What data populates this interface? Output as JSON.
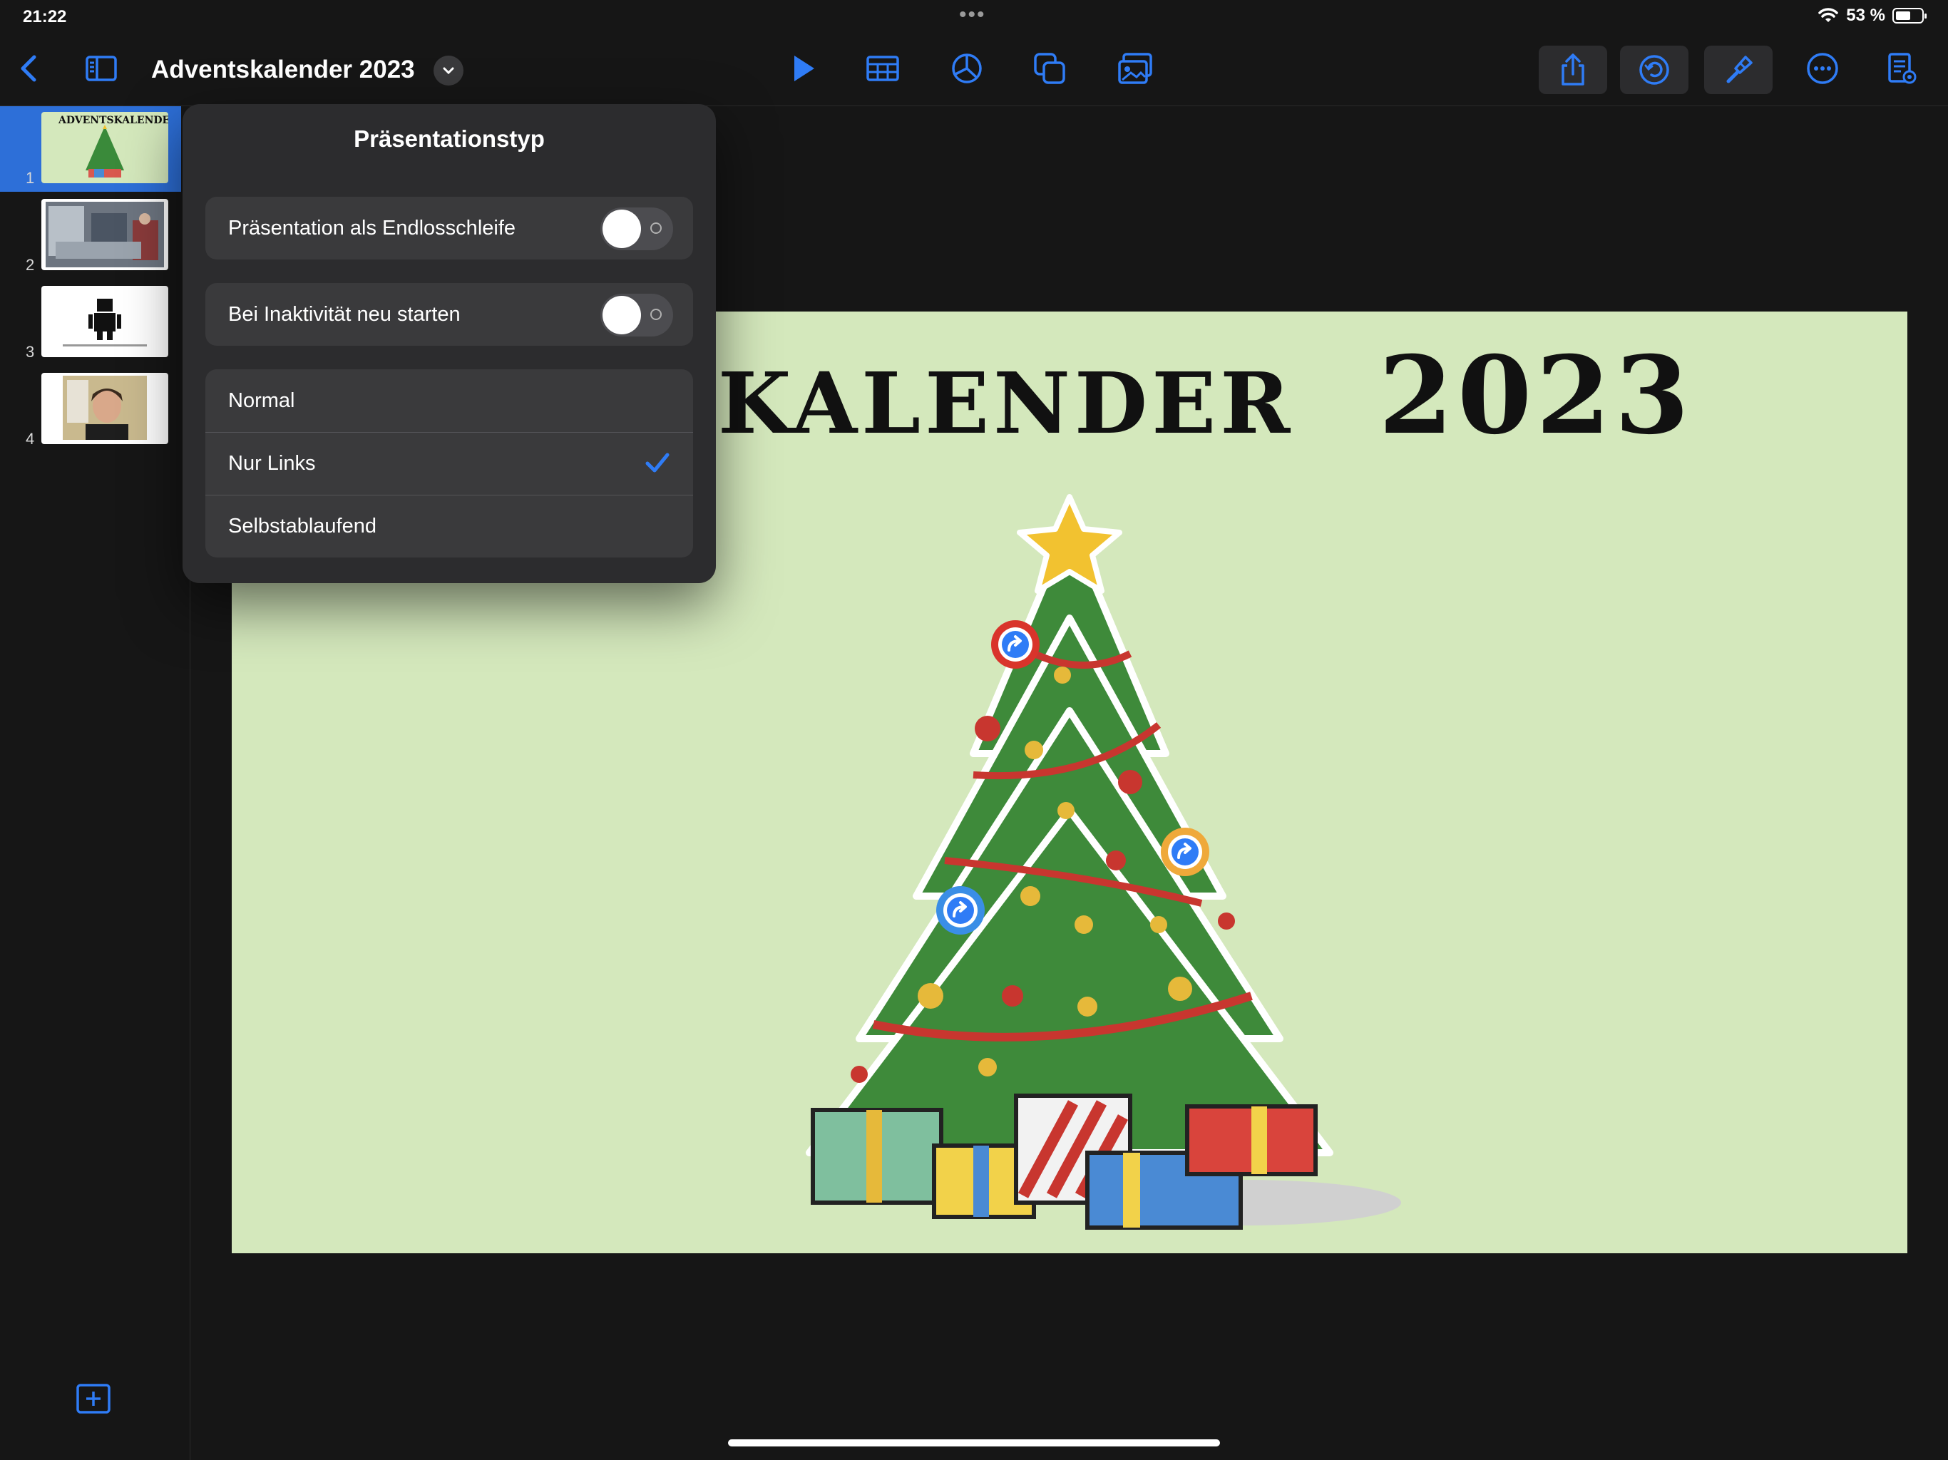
{
  "status_bar": {
    "time": "21:22",
    "battery_text": "53 %",
    "battery_level": 0.53
  },
  "toolbar": {
    "document_title": "Adventskalender 2023",
    "buttons": [
      "back-icon",
      "sidebar-icon",
      "title-menu-chevron-icon",
      "play-icon",
      "table-icon",
      "chart-icon",
      "shape-icon",
      "media-icon",
      "share-icon",
      "collaborate-icon",
      "format-brush-icon",
      "more-icon",
      "presenter-notes-icon"
    ]
  },
  "sidebar": {
    "slides": [
      {
        "number": "1",
        "selected": true
      },
      {
        "number": "2",
        "selected": false
      },
      {
        "number": "3",
        "selected": false
      },
      {
        "number": "4",
        "selected": false
      }
    ]
  },
  "slide": {
    "title_part_1": "NTSKALENDER",
    "title_part_2": "2023",
    "background_color": "#d4e8bc",
    "link_markers": [
      "red",
      "orange",
      "blue"
    ]
  },
  "popover": {
    "title": "Präsentationstyp",
    "toggles": [
      {
        "label": "Präsentation als Endlosschleife",
        "on": false
      },
      {
        "label": "Bei Inaktivität neu starten",
        "on": false
      }
    ],
    "options": [
      {
        "label": "Normal",
        "checked": false
      },
      {
        "label": "Nur Links",
        "checked": true
      },
      {
        "label": "Selbstablaufend",
        "checked": false
      }
    ]
  },
  "colors": {
    "accent": "#2f7cf6",
    "popover_bg": "#2c2c2e",
    "cell_bg": "#3a3a3c"
  }
}
